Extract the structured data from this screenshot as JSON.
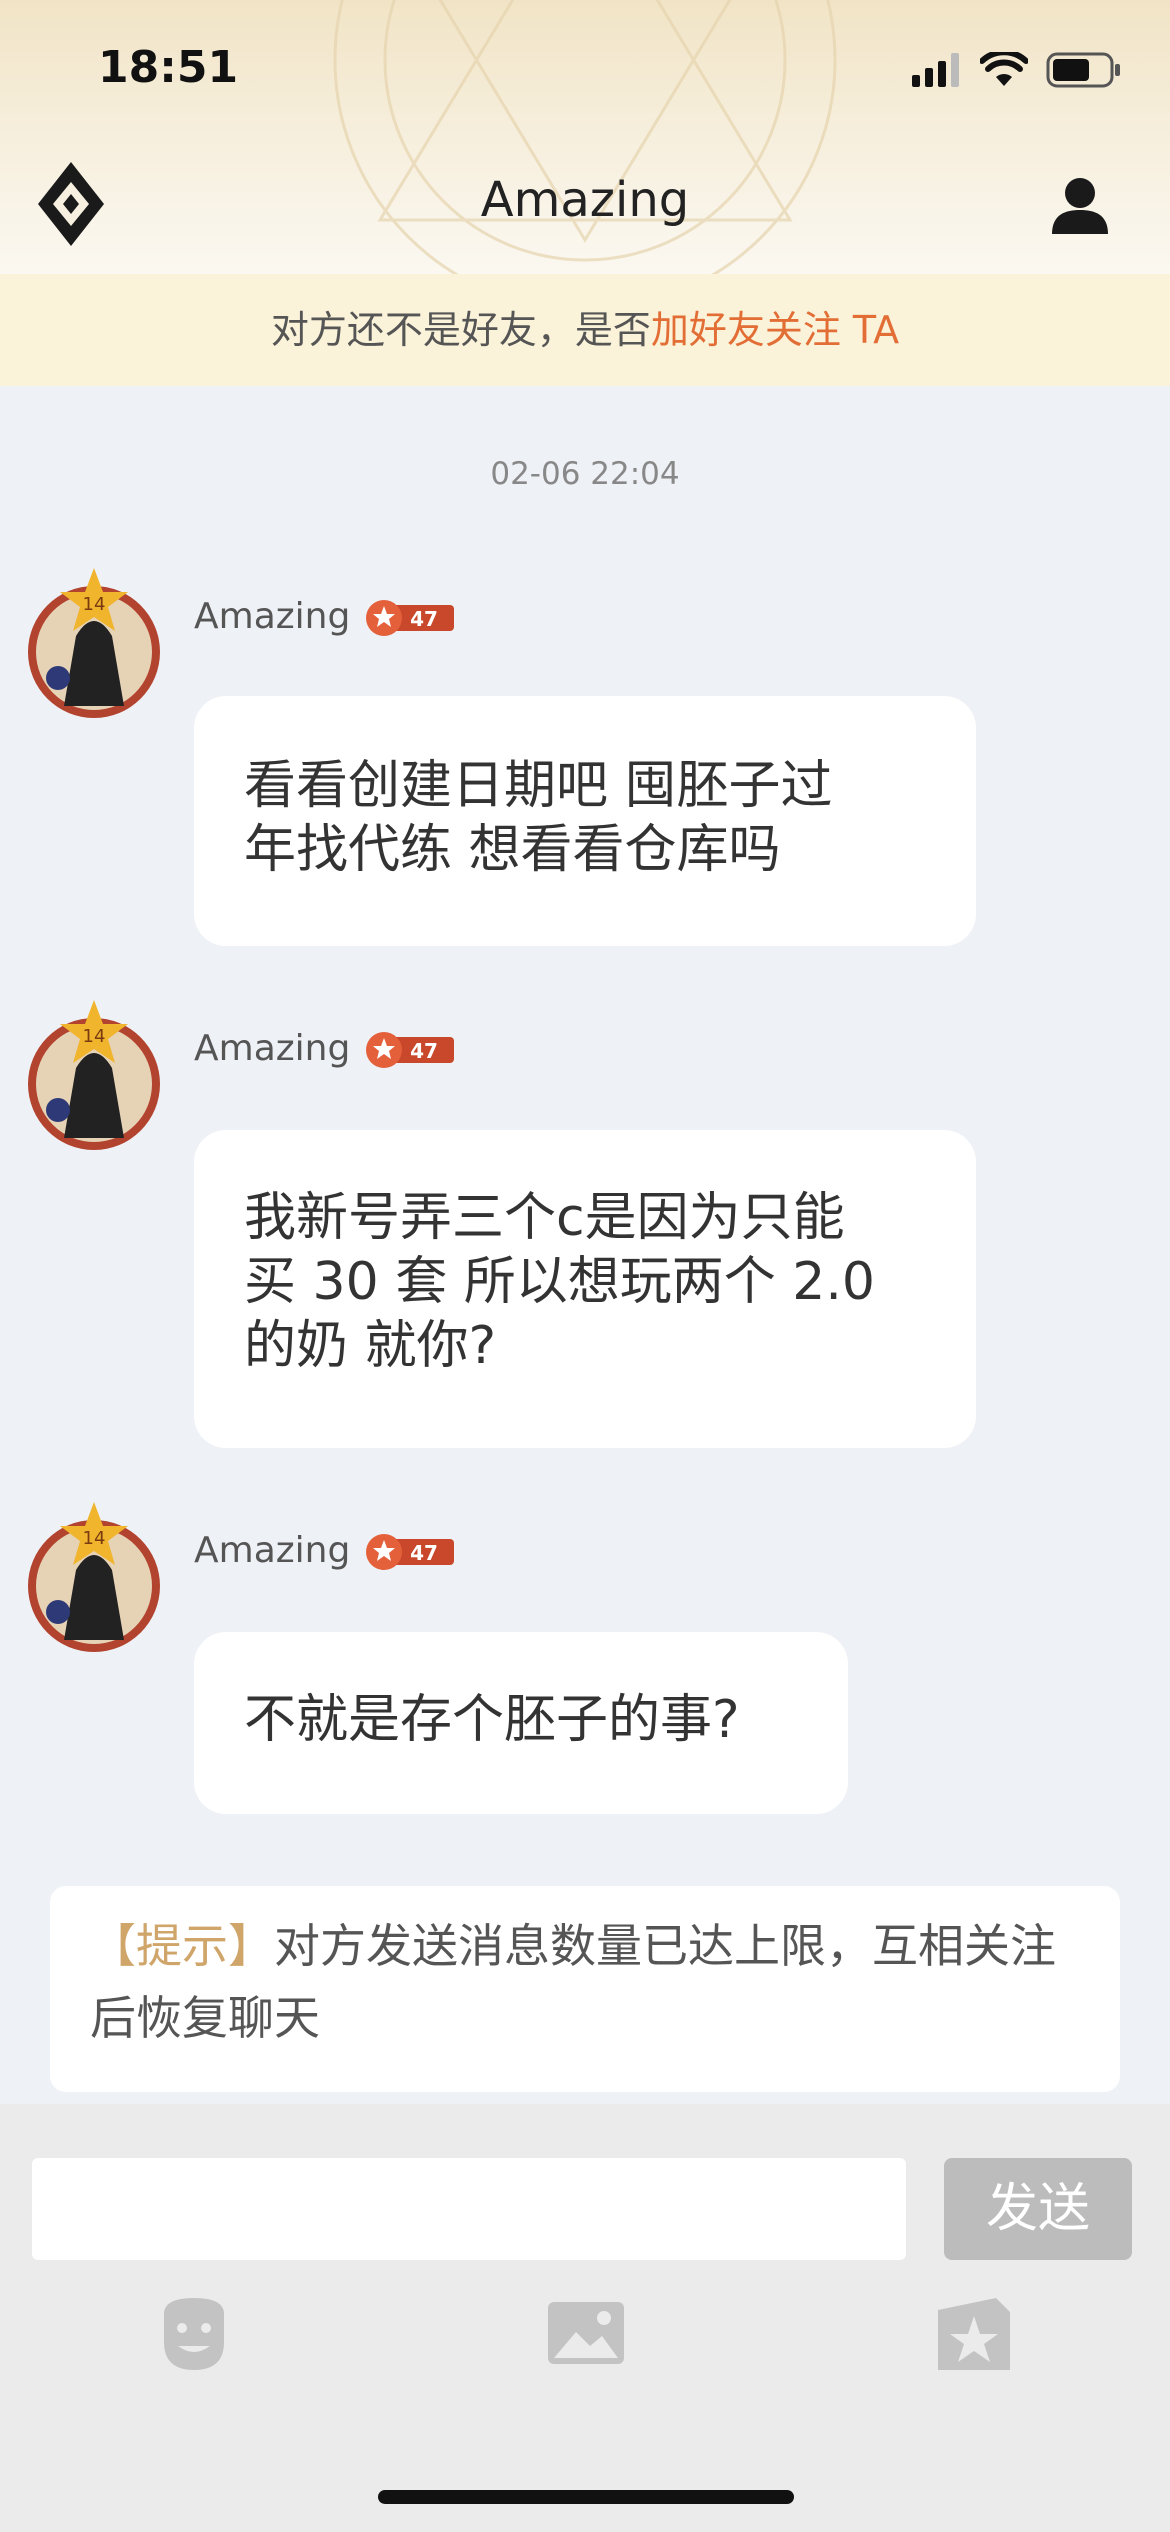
{
  "status_bar": {
    "time": "18:51"
  },
  "header": {
    "title": "Amazing"
  },
  "friend_banner": {
    "text": "对方还不是好友，是否",
    "link": "加好友关注 TA"
  },
  "chat": {
    "timestamp": "02-06 22:04",
    "messages": [
      {
        "sender": "Amazing",
        "level": "47",
        "avatar_level": "14",
        "text": "看看创建日期吧  囤胚子过\n年找代练  想看看仓库吗"
      },
      {
        "sender": "Amazing",
        "level": "47",
        "avatar_level": "14",
        "text": "我新号弄三个c是因为只能\n买 30 套 所以想玩两个 2.0\n的奶 就你?"
      },
      {
        "sender": "Amazing",
        "level": "47",
        "avatar_level": "14",
        "text": "不就是存个胚子的事?"
      }
    ]
  },
  "notice": {
    "tag": "【提示】",
    "text": "对方发送消息数量已达上限，互相关注后恢复聊天"
  },
  "composer": {
    "input_value": "",
    "placeholder": "",
    "send_label": "发送",
    "tools": [
      "emoji-icon",
      "image-icon",
      "sticker-icon"
    ]
  },
  "colors": {
    "accent": "#e26e36",
    "notice_tag": "#cfa56a",
    "badge": "#c9472a",
    "send_disabled": "#bcbcbc"
  }
}
